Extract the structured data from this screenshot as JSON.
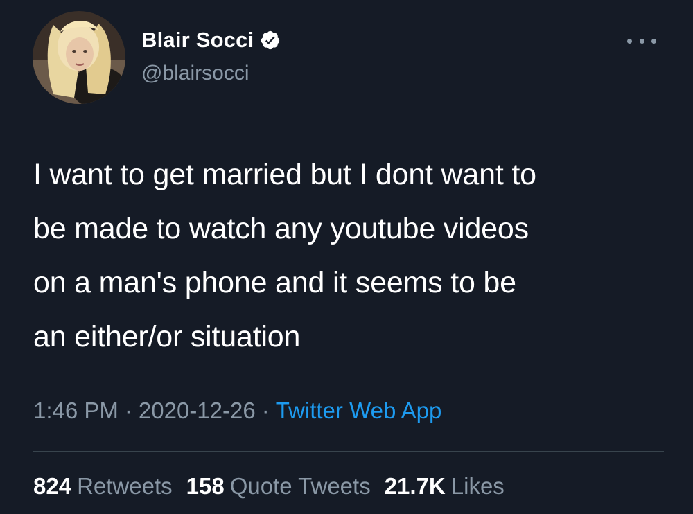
{
  "author": {
    "display_name": "Blair Socci",
    "handle": "@blairsocci",
    "verified_icon": "verified-badge-icon",
    "avatar_icon": "profile-photo"
  },
  "menu": {
    "more_icon": "ellipsis-icon"
  },
  "tweet": {
    "lines": [
      "I want to get married but I dont want to",
      "be made to watch any youtube videos",
      "on a man's phone and it seems to be",
      "an either/or situation"
    ],
    "time": "1:46 PM",
    "separator": "·",
    "date": "2020-12-26",
    "source": "Twitter Web App"
  },
  "stats": {
    "retweets_count": "824",
    "retweets_label": "Retweets",
    "quotes_count": "158",
    "quotes_label": "Quote Tweets",
    "likes_count": "21.7K",
    "likes_label": "Likes"
  },
  "colors": {
    "background": "#151b26",
    "secondary_text": "#8a98a6",
    "link": "#1d9bf0",
    "divider": "#38444d"
  }
}
